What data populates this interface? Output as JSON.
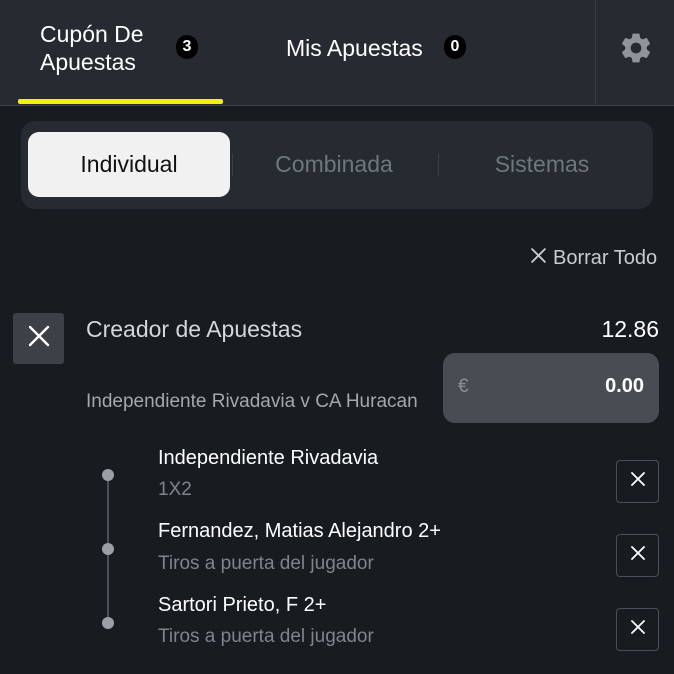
{
  "header": {
    "tab_cupon": {
      "label": "Cupón De\nApuestas",
      "count": "3"
    },
    "tab_mis": {
      "label": "Mis Apuestas",
      "count": "0"
    },
    "accent_color": "#f5f011",
    "settings_icon": "gear-icon"
  },
  "bet_types": {
    "options": [
      "Individual",
      "Combinada",
      "Sistemas"
    ],
    "selected": "Individual"
  },
  "clear_all": {
    "label": "Borrar Todo",
    "icon": "close-icon"
  },
  "bet": {
    "title": "Creador de Apuestas",
    "odds": "12.86",
    "event": "Independiente Rivadavia v CA Huracan",
    "stake": {
      "currency": "€",
      "value": "0.00"
    },
    "legs": [
      {
        "selection": "Independiente Rivadavia",
        "market": "1X2"
      },
      {
        "selection": "Fernandez, Matias Alejandro 2+",
        "market": "Tiros a puerta del jugador"
      },
      {
        "selection": "Sartori Prieto, F 2+",
        "market": "Tiros a puerta del jugador"
      }
    ]
  }
}
